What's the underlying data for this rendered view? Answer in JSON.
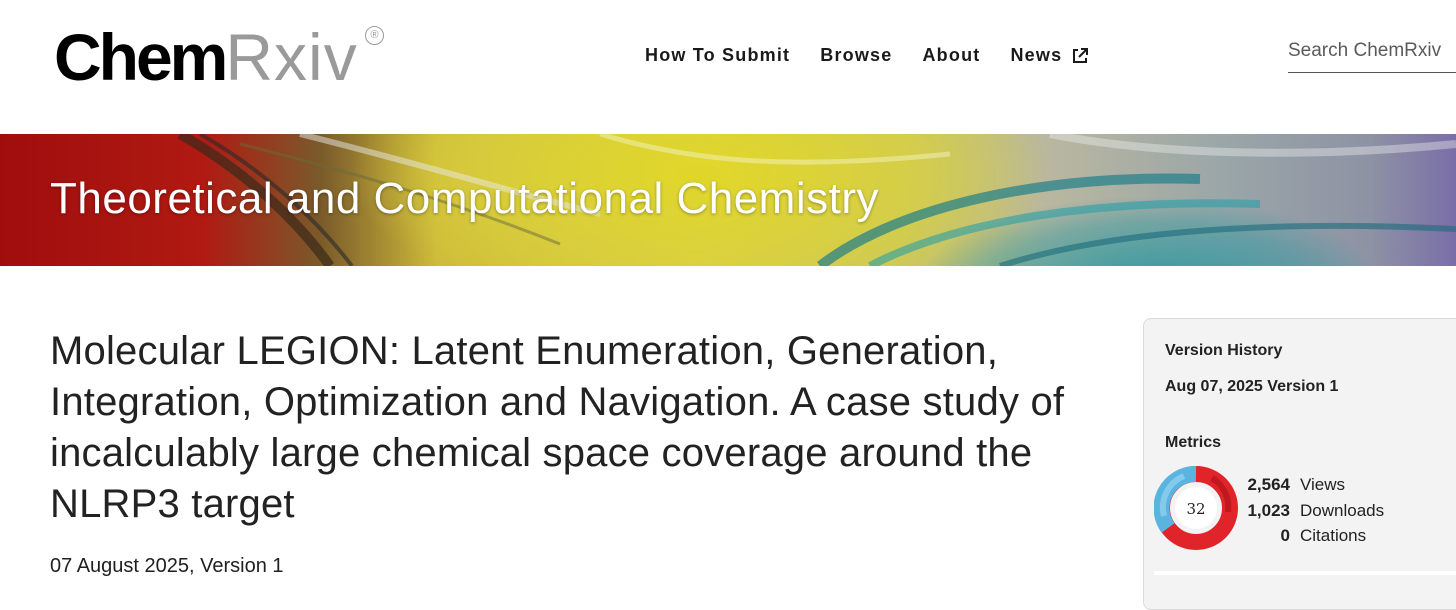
{
  "header": {
    "logo": {
      "part1": "Chem",
      "part2": "Rxiv",
      "registered": "®"
    },
    "nav": [
      {
        "label": "How To Submit"
      },
      {
        "label": "Browse"
      },
      {
        "label": "About"
      },
      {
        "label": "News",
        "icon": "external-link-icon"
      }
    ],
    "search": {
      "placeholder": "Search ChemRxiv"
    }
  },
  "banner": {
    "title": "Theoretical and Computational Chemistry"
  },
  "article": {
    "title": "Molecular LEGION: Latent Enumeration, Generation, Integration, Optimization and Navigation. A case study of incalculably large chemical space coverage around the NLRP3 target",
    "date": "07 August 2025, Version 1"
  },
  "sidebar": {
    "version_history": {
      "label": "Version History",
      "entry": {
        "date": "Aug 07, 2025",
        "version": "Version 1"
      }
    },
    "metrics": {
      "label": "Metrics",
      "altmetric_score": "32",
      "items": [
        {
          "value": "2,564",
          "label": "Views"
        },
        {
          "value": "1,023",
          "label": "Downloads"
        },
        {
          "value": "0",
          "label": "Citations"
        }
      ]
    }
  },
  "colors": {
    "accent_red": "#a00d0d",
    "altmetric_blue": "#5ab4e0",
    "altmetric_red": "#e0242a"
  }
}
